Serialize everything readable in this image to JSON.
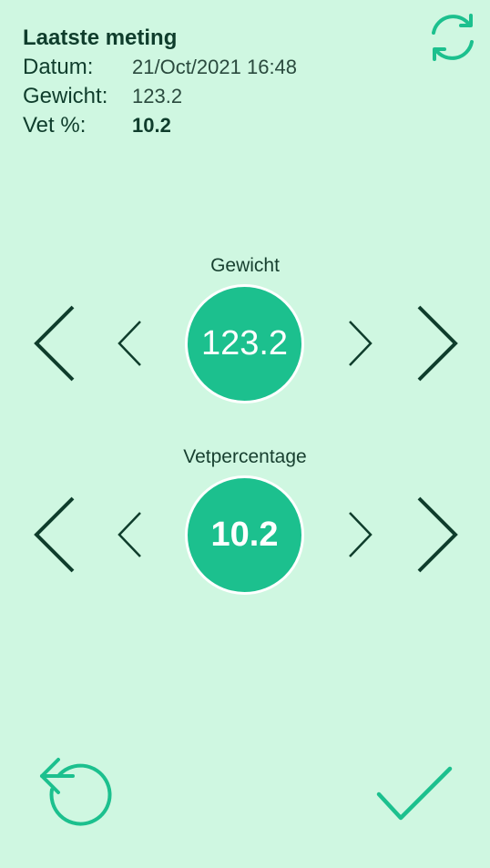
{
  "last_measurement": {
    "title": "Laatste meting",
    "date_label": "Datum:",
    "date_value": "21/Oct/2021 16:48",
    "weight_label": "Gewicht:",
    "weight_value": "123.2",
    "fat_label": "Vet %:",
    "fat_value": "10.2"
  },
  "weight_control": {
    "label": "Gewicht",
    "value": "123.2"
  },
  "fat_control": {
    "label": "Vetpercentage",
    "value": "10.2"
  },
  "icons": {
    "refresh": "refresh-icon",
    "undo": "undo-icon",
    "confirm": "check-icon",
    "decrease_large": "chevron-left-large-icon",
    "decrease_small": "chevron-left-small-icon",
    "increase_small": "chevron-right-small-icon",
    "increase_large": "chevron-right-large-icon"
  },
  "colors": {
    "background": "#cff7e1",
    "accent": "#1cc08e",
    "dark": "#0f3d2c"
  }
}
